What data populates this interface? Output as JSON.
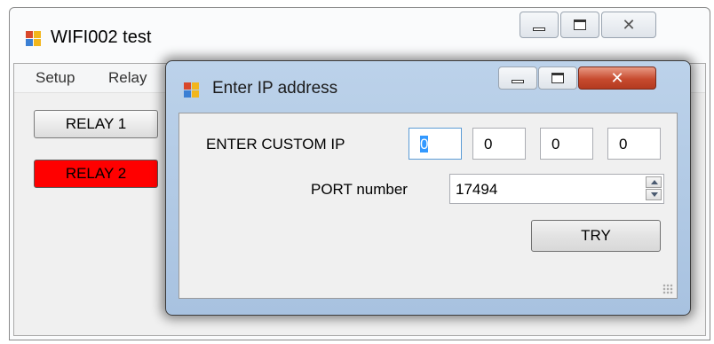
{
  "main_window": {
    "title": "WIFI002 test",
    "menu": [
      "Setup",
      "Relay"
    ],
    "relay_buttons": [
      {
        "label": "RELAY 1",
        "color": "#e6e6e6"
      },
      {
        "label": "RELAY 2",
        "color": "#ff0000"
      }
    ]
  },
  "dialog": {
    "title": "Enter IP address",
    "ip_label": "ENTER CUSTOM IP",
    "ip_octets": [
      "0",
      "0",
      "0",
      "0"
    ],
    "port_label": "PORT number",
    "port_value": "17494",
    "try_label": "TRY"
  }
}
